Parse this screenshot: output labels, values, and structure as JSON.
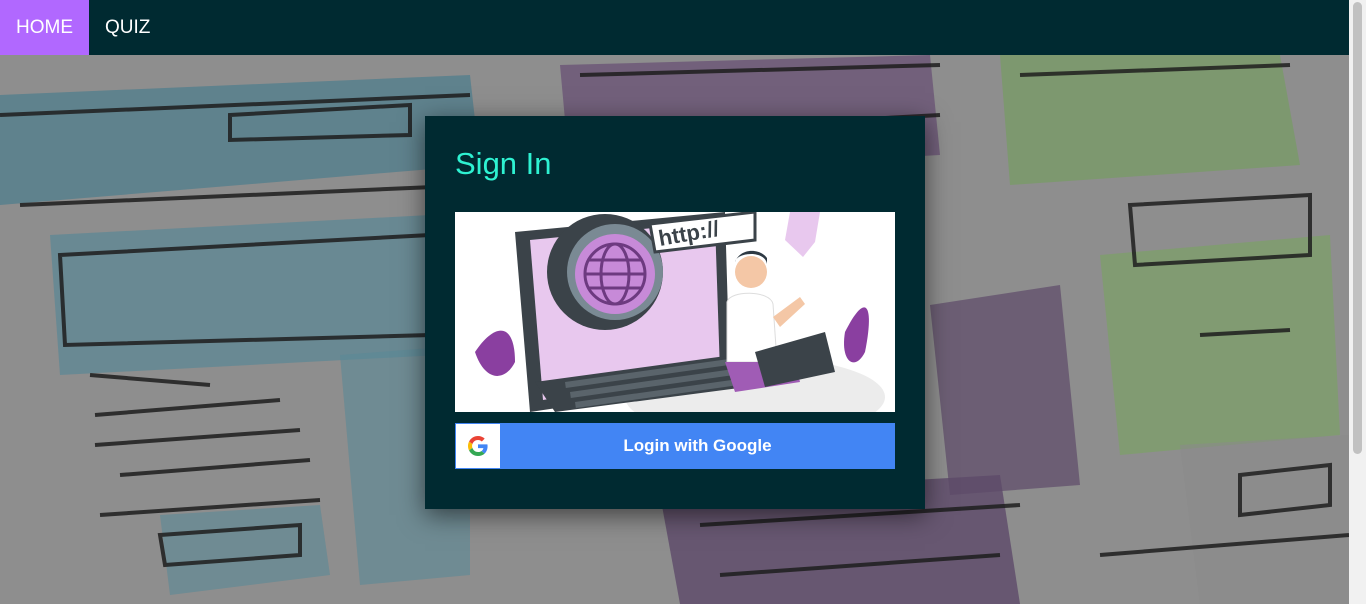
{
  "nav": {
    "items": [
      {
        "label": "HOME",
        "active": true
      },
      {
        "label": "QUIZ",
        "active": false
      }
    ]
  },
  "signin": {
    "title": "Sign In",
    "illustration_text": "http://",
    "google_button_label": "Login with Google",
    "google_icon": "google-g-icon"
  },
  "colors": {
    "navbar_bg": "#002a31",
    "nav_active_bg": "#b168ff",
    "card_bg": "#002a31",
    "title_color": "#2ef2d2",
    "google_blue": "#4285f4"
  }
}
